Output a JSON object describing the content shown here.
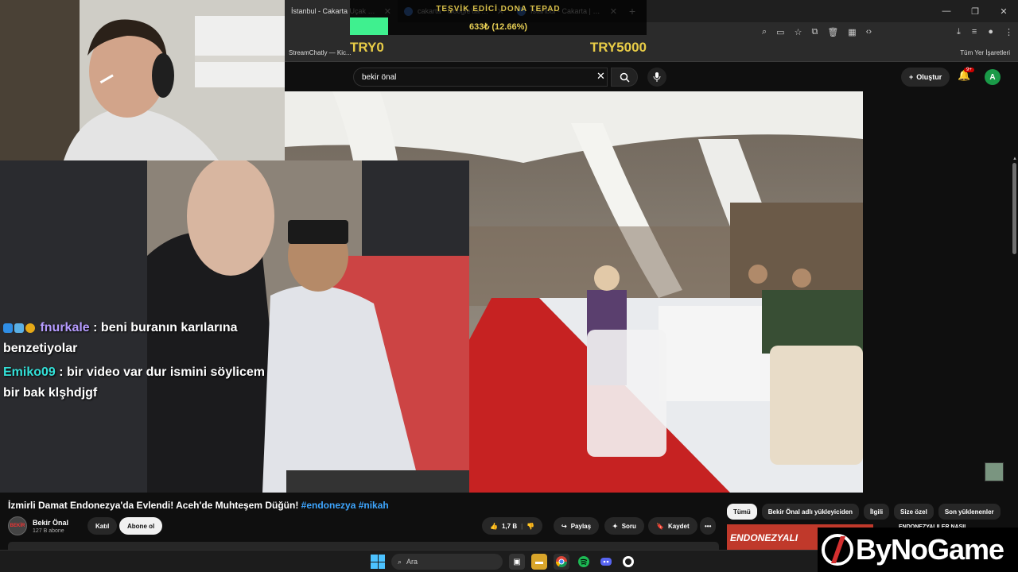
{
  "browser": {
    "tabs": [
      {
        "label": "İstanbul - Cakarta Uçak Seferi",
        "active": true
      },
      {
        "label": "cakarta - Google'da Ara",
        "active": false
      },
      {
        "label": "İstanbul - Cakarta | Google Uçuş",
        "active": false
      }
    ],
    "new_tab_label": "+",
    "bookmark_left": "StreamChatly — Kic...",
    "bookmark_right": "Tüm Yer İşaretleri"
  },
  "donation": {
    "title": "TEŞVİK EDİCİ DONA TEPAD",
    "amount": "633₺ (12.66%)",
    "progress": 0.1266,
    "min_label": "TRY0",
    "max_label": "TRY5000",
    "bar_color": "#3ff08f"
  },
  "youtube": {
    "search_value": "bekir önal",
    "create_label": "Oluştur",
    "notification_count": "9+",
    "avatar_letter": "A",
    "video_title": "İzmirli Damat Endonezya'da Evlendi! Aceh'de Muhteşem Düğün!",
    "video_tags": "#endonezya #nikah",
    "channel_name": "Bekir Önal",
    "channel_subs": "127 B abone",
    "join_label": "Katıl",
    "subscribe_label": "Abone ol",
    "like_count": "1,7 B",
    "share_label": "Paylaş",
    "ask_label": "Soru",
    "save_label": "Kaydet",
    "more_label": "•••",
    "chips": [
      "Tümü",
      "Bekir Önal adlı yükleyiciden",
      "İlgili",
      "Size özel",
      "Son yüklenenler"
    ],
    "rec_thumb_text": "ENDONEZYALI",
    "rec_title": "ENDONEZYALILER NASIL"
  },
  "chat": [
    {
      "user": "fnurkale",
      "user_color": "#b69cff",
      "message": "beni buranın karılarına benzetiyolar"
    },
    {
      "user": "Emiko09",
      "user_color": "#33e0d8",
      "message": "bir video var dur ismini söylicem bir bak klşhdjgf"
    }
  ],
  "taskbar": {
    "search_placeholder": "Ara"
  },
  "watermark": {
    "text": "ByNoGame"
  }
}
